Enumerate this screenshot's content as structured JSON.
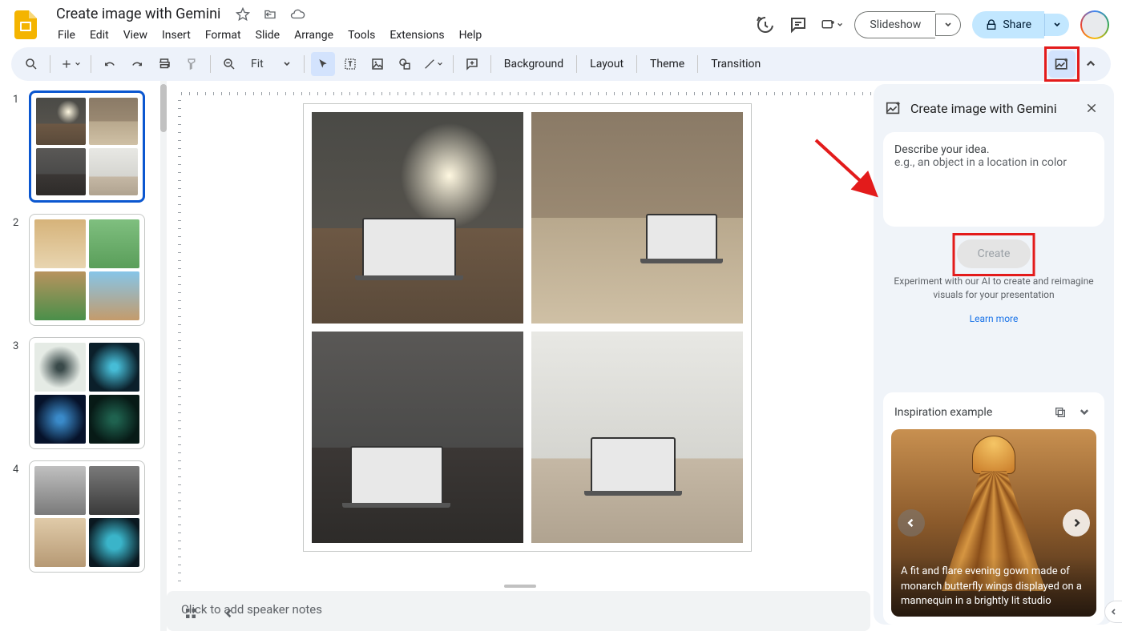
{
  "doc_title": "Create image with Gemini",
  "menus": [
    "File",
    "Edit",
    "View",
    "Insert",
    "Format",
    "Slide",
    "Arrange",
    "Tools",
    "Extensions",
    "Help"
  ],
  "header": {
    "slideshow": "Slideshow",
    "share": "Share"
  },
  "toolbar": {
    "zoom": "Fit",
    "background": "Background",
    "layout": "Layout",
    "theme": "Theme",
    "transition": "Transition"
  },
  "slides": [
    "1",
    "2",
    "3",
    "4"
  ],
  "speaker_notes_placeholder": "Click to add speaker notes",
  "gemini": {
    "title": "Create image with Gemini",
    "prompt_line1": "Describe your idea.",
    "prompt_line2": "e.g., an object in a location in color",
    "create": "Create",
    "desc": "Experiment with our AI to create and reimagine visuals for your presentation",
    "learn": "Learn more"
  },
  "inspiration": {
    "title": "Inspiration example",
    "caption": "A fit and flare evening gown made of monarch butterfly wings displayed on a mannequin in a brightly lit studio"
  }
}
